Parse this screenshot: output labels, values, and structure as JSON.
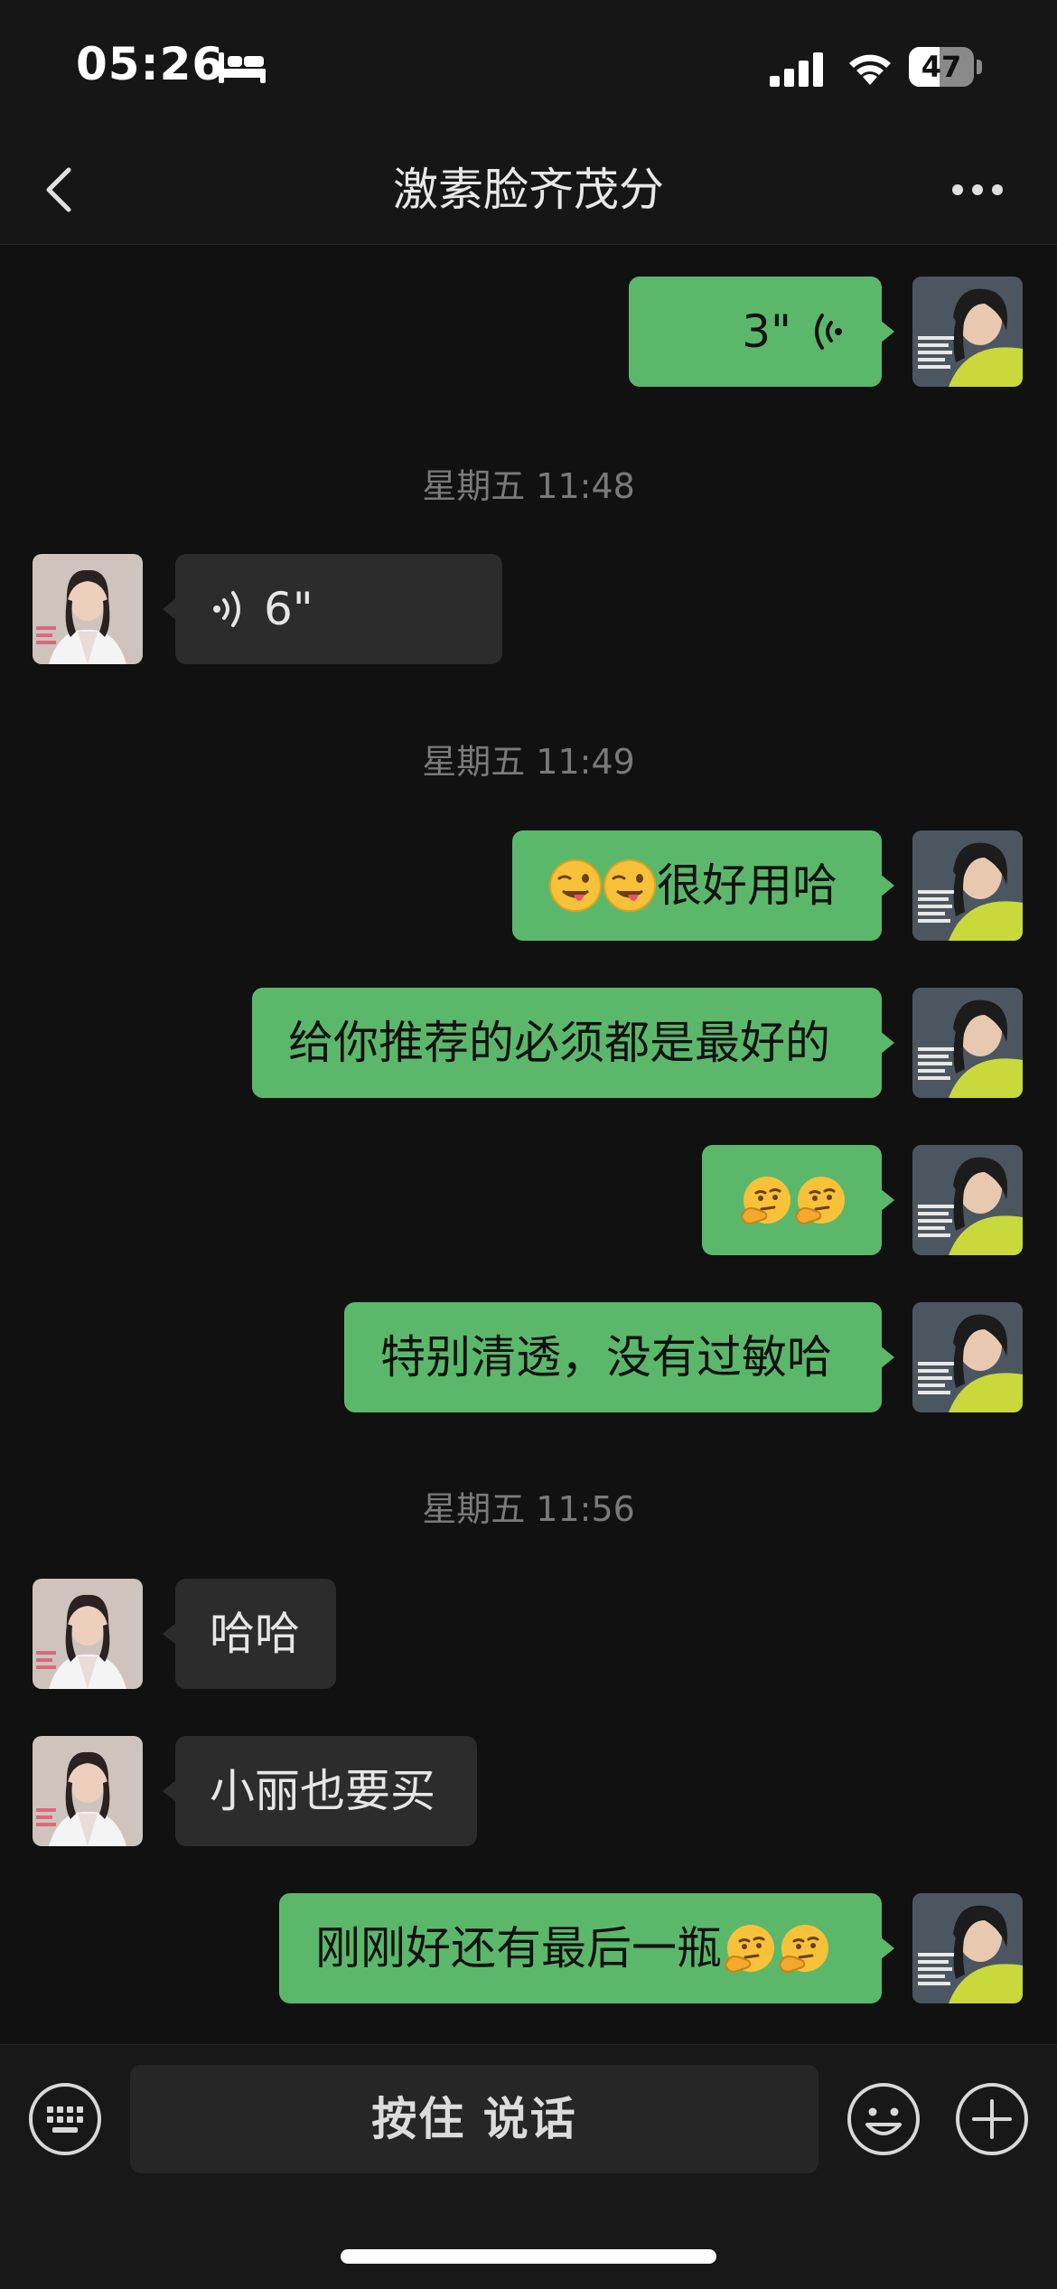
{
  "status_bar": {
    "time": "05:26",
    "battery_percent": "47",
    "battery_level": 0.47
  },
  "nav": {
    "title": "激素脸齐茂分"
  },
  "messages": {
    "m1_voice_duration": "3\"",
    "ts1": "星期五 11:48",
    "m2_voice_duration": "6\"",
    "ts2": "星期五 11:49",
    "m3_text": "很好用哈",
    "m4_text": "给你推荐的必须都是最好的",
    "m6_text": "特别清透，没有过敏哈",
    "ts3": "星期五 11:56",
    "m7_text": "哈哈",
    "m8_text": "小丽也要买",
    "m9_text": "刚刚好还有最后一瓶"
  },
  "input_bar": {
    "hold_to_talk_label": "按住 说话"
  },
  "icons": [
    "bed-icon",
    "signal-icon",
    "wifi-icon",
    "back-icon",
    "more-icon",
    "voice-wave-icon",
    "wink-tongue-emoji",
    "thinking-emoji",
    "keyboard-icon",
    "smile-icon",
    "plus-icon"
  ],
  "colors": {
    "background": "#111111",
    "outgoing_bubble": "#5bb86b",
    "incoming_bubble": "#2c2c2c",
    "timestamp": "#7a7a7a"
  }
}
